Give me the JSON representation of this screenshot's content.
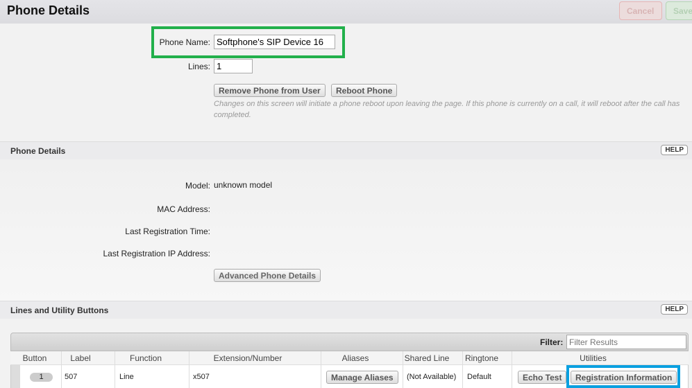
{
  "header": {
    "title": "Phone Details",
    "cancel": "Cancel",
    "save": "Save"
  },
  "form": {
    "phone_name_label": "Phone Name:",
    "phone_name_value": "Softphone's SIP Device 16",
    "lines_label": "Lines:",
    "lines_value": "1",
    "remove_btn": "Remove Phone from User",
    "reboot_btn": "Reboot Phone",
    "note": "Changes on this screen will initiate a phone reboot upon leaving the page. If this phone is currently on a call, it will reboot after the call has completed."
  },
  "details": {
    "title": "Phone Details",
    "help": "HELP",
    "model_label": "Model:",
    "model_value": "unknown model",
    "mac_label": "MAC Address:",
    "reg_time_label": "Last Registration Time:",
    "reg_ip_label": "Last Registration IP Address:",
    "advanced_btn": "Advanced Phone Details"
  },
  "lines": {
    "title": "Lines and Utility Buttons",
    "help": "HELP",
    "filter_label": "Filter:",
    "filter_placeholder": "Filter Results",
    "columns": [
      "Button",
      "Label",
      "Function",
      "Extension/Number",
      "Aliases",
      "Shared Line",
      "Ringtone",
      "Utilities"
    ],
    "rows": [
      {
        "button": "1",
        "label": "507",
        "function": "Line",
        "extension": "x507",
        "aliases_btn": "Manage Aliases",
        "shared": "(Not Available)",
        "ringtone": "Default",
        "echo_btn": "Echo Test",
        "reg_btn": "Registration Information"
      }
    ]
  },
  "highlights": {
    "green": "#22b04b",
    "blue": "#0aa0e0"
  }
}
